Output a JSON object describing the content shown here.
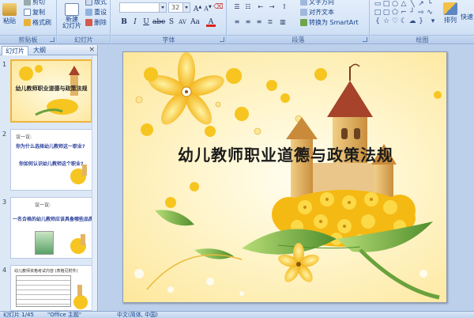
{
  "ribbon": {
    "clipboard": {
      "label": "剪贴板",
      "paste": "粘贴",
      "cut": "剪切",
      "copy": "复制",
      "format_painter": "格式刷"
    },
    "slides": {
      "label": "幻灯片",
      "new_slide": "新建\n幻灯片",
      "layout": "版式",
      "reset": "重设",
      "delete": "删除"
    },
    "font": {
      "label": "字体",
      "font_name": "",
      "font_size": "32"
    },
    "paragraph": {
      "label": "段落",
      "text_direction": "文字方向",
      "align_text": "对齐文本",
      "smartart": "转换为 SmartArt"
    },
    "drawing": {
      "label": "绘图",
      "arrange": "排列",
      "quick_styles": "快速"
    }
  },
  "left_pane": {
    "tabs": [
      "幻灯片",
      "大纲"
    ],
    "close": "×",
    "thumbs": [
      {
        "num": "1",
        "text": "幼儿教师职业道德与政策法规"
      },
      {
        "num": "2",
        "lead": "议一议:",
        "q1": "你为什么选择幼儿教师这一职业?",
        "q2": "你如何认识幼儿教师这个职业?"
      },
      {
        "num": "3",
        "lead": "议一议:",
        "q1": "一名合格的幼儿教师应该具备哪些品质?"
      },
      {
        "num": "4",
        "lead": "幼儿教师资格考试内容 (表格见附件)"
      }
    ]
  },
  "slide": {
    "title": "幼儿教师职业道德与政策法规"
  },
  "status": {
    "slide_no": "幻灯片 1/45",
    "theme": "\"Office 主题\"",
    "lang": "中文(简体, 中国)"
  },
  "colors": {
    "ribbon": "#d2e2f6",
    "petal": "#f7c51f",
    "petal_dark": "#e9a30e",
    "leaf": "#6aa23d",
    "roof": "#a6432a",
    "tower": "#e2b466"
  }
}
